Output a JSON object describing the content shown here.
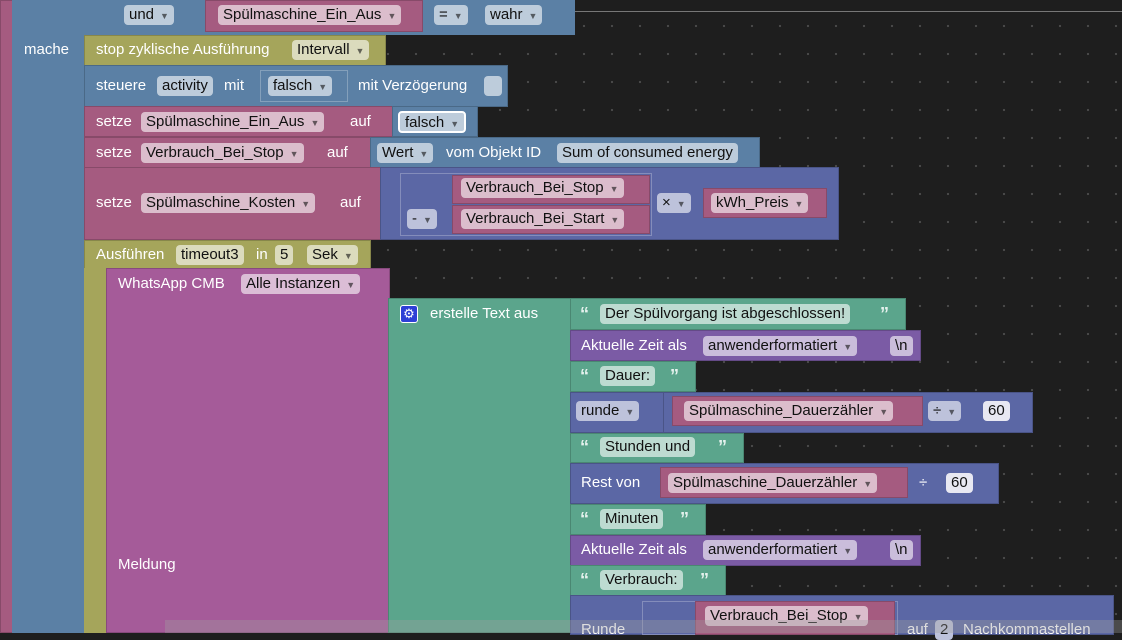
{
  "condition": {
    "op": "und",
    "var": "Spülmaschine_Ein_Aus",
    "cmp": "=",
    "value": "wahr"
  },
  "mache_label": "mache",
  "stop": {
    "label": "stop zyklische Ausführung",
    "target": "Intervall"
  },
  "steuere": {
    "label": "steuere",
    "device": "activity",
    "mit": "mit",
    "value": "falsch",
    "delay_label": "mit Verzögerung"
  },
  "set1": {
    "label": "setze",
    "var": "Spülmaschine_Ein_Aus",
    "auf": "auf",
    "value": "falsch"
  },
  "set2": {
    "label": "setze",
    "var": "Verbrauch_Bei_Stop",
    "auf": "auf",
    "mode": "Wert",
    "from": "vom Objekt ID",
    "object": "Sum of consumed energy"
  },
  "set3": {
    "label": "setze",
    "var": "Spülmaschine_Kosten",
    "auf": "auf",
    "a": "Verbrauch_Bei_Stop",
    "b": "Verbrauch_Bei_Start",
    "minus": "-",
    "times": "×",
    "price": "kWh_Preis"
  },
  "timeout": {
    "label": "Ausführen",
    "name": "timeout3",
    "in": "in",
    "amount": "5",
    "unit": "Sek"
  },
  "whatsapp": {
    "label": "WhatsApp CMB",
    "instance": "Alle Instanzen",
    "message_label": "Meldung"
  },
  "join": {
    "label": "erstelle Text aus",
    "icon": "gear-icon"
  },
  "rows": {
    "t1": "Der Spülvorgang ist abgeschlossen!",
    "time_label": "Aktuelle Zeit als",
    "time_format": "anwenderformatiert",
    "newline": "\\n",
    "t2": "Dauer:",
    "round": "runde",
    "counter": "Spülmaschine_Dauerzähler",
    "div": "÷",
    "sixty": "60",
    "t3": "Stunden und",
    "rest": "Rest von",
    "t4": "Minuten",
    "t5": "Verbrauch:",
    "runde2": "Runde",
    "stopvar": "Verbrauch_Bei_Stop",
    "auf": "auf",
    "digits": "2",
    "decimals": "Nachkommastellen"
  },
  "colors": {
    "variables": "#a55b80",
    "devices": "#5b80a5",
    "timers": "#a5a55b",
    "text": "#5ba58c",
    "math": "#5b67a5",
    "whatsapp": "#a55b99",
    "time": "#7b5ba5",
    "background": "#1e1e1e"
  }
}
